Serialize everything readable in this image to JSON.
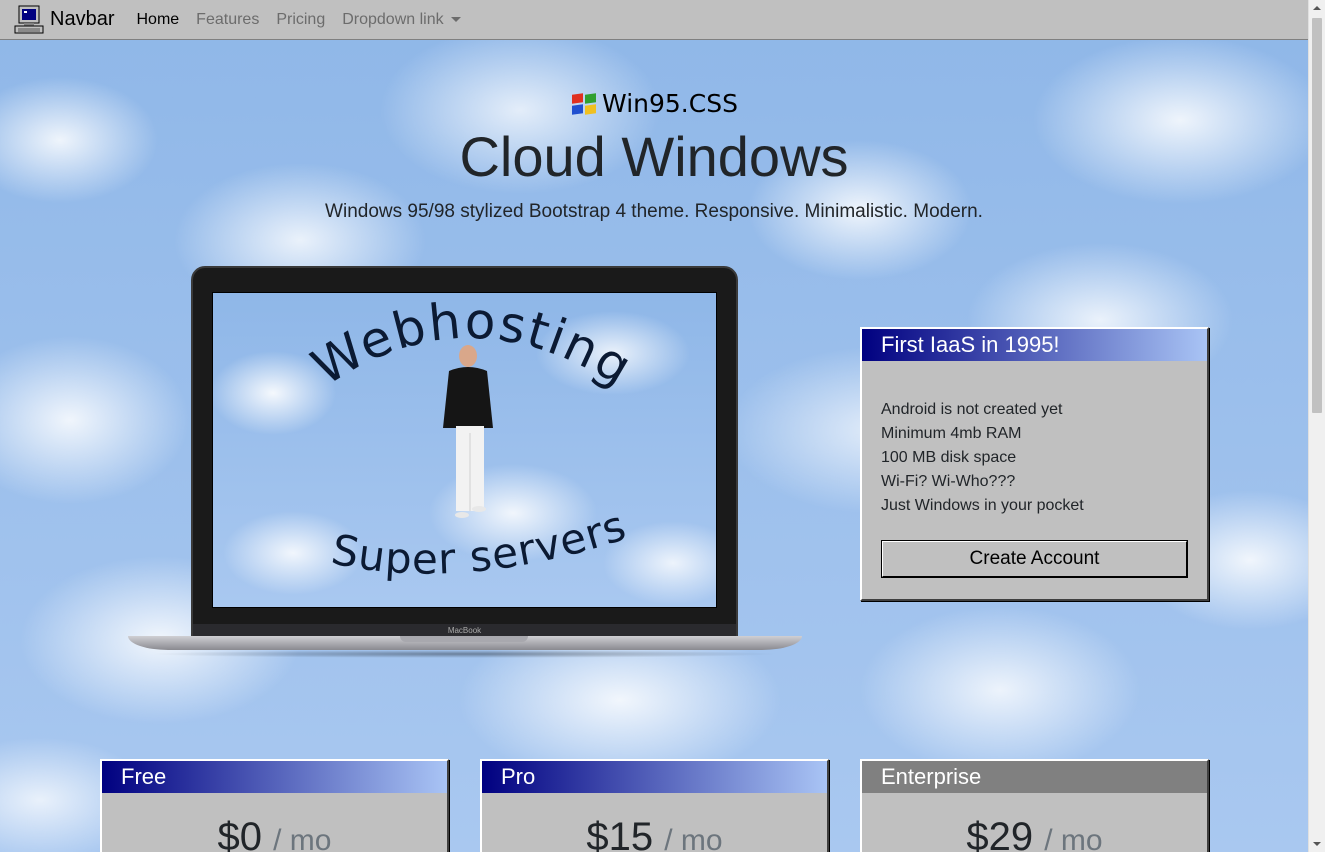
{
  "navbar": {
    "brand": "Navbar",
    "links": [
      {
        "label": "Home",
        "active": true
      },
      {
        "label": "Features",
        "active": false
      },
      {
        "label": "Pricing",
        "active": false
      }
    ],
    "dropdown_label": "Dropdown link"
  },
  "hero": {
    "brand": "Win95.CSS",
    "title": "Cloud Windows",
    "subtitle": "Windows 95/98 stylized Bootstrap 4 theme. Responsive. Minimalistic. Modern."
  },
  "laptop": {
    "screen_text_top": "Webhosting",
    "screen_text_bottom": "Super servers",
    "base_label": "MacBook"
  },
  "feature_card": {
    "title": "First IaaS in 1995!",
    "items": [
      "Android is not created yet",
      "Minimum 4mb RAM",
      "100 MB disk space",
      "Wi-Fi? Wi-Who???",
      "Just Windows in your pocket"
    ],
    "button_label": "Create Account"
  },
  "pricing": [
    {
      "name": "Free",
      "price": "$0",
      "period": "/ mo"
    },
    {
      "name": "Pro",
      "price": "$15",
      "period": "/ mo"
    },
    {
      "name": "Enterprise",
      "price": "$29",
      "period": "/ mo"
    }
  ],
  "colors": {
    "title_bar_start": "#000080",
    "title_bar_end": "#a9c4f5",
    "panel": "#c0c0c0",
    "disabled_title": "#808080"
  }
}
